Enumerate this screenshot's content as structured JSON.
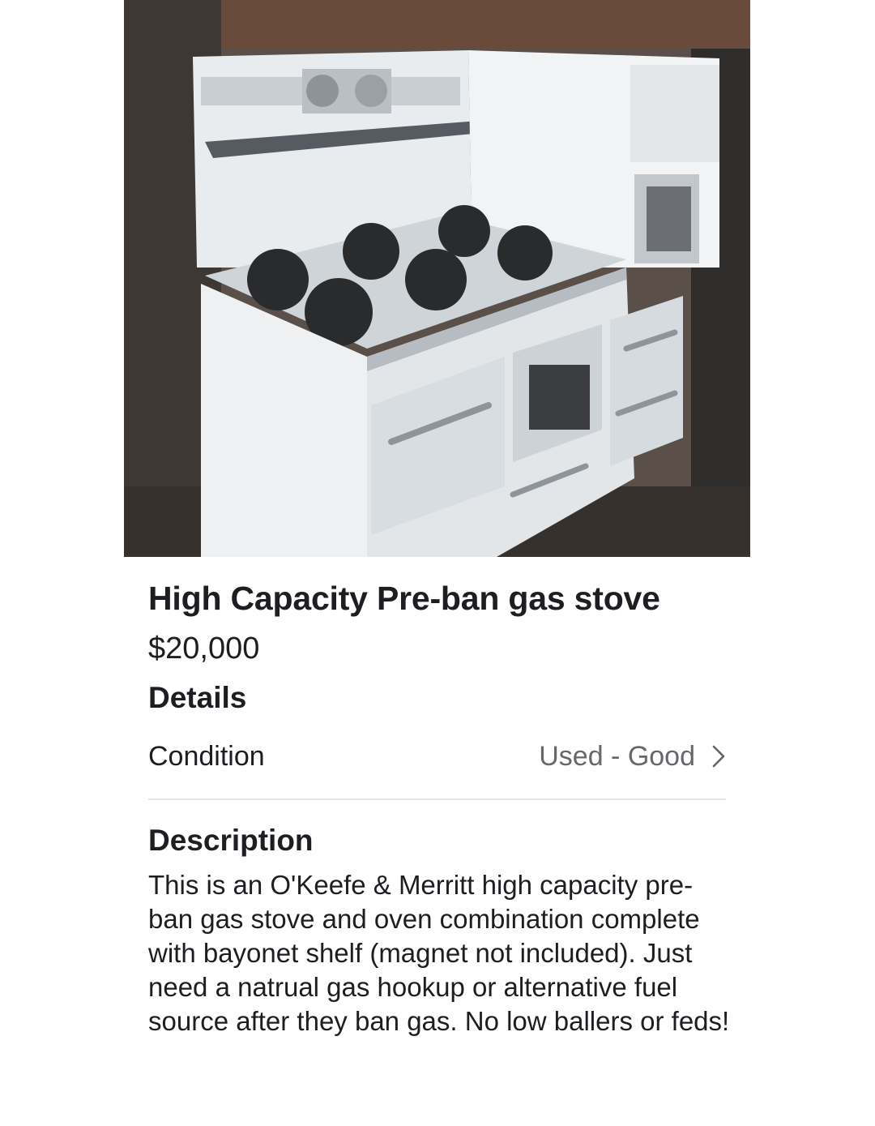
{
  "listing": {
    "title": "High Capacity Pre-ban gas stove",
    "price": "$20,000"
  },
  "details": {
    "heading": "Details",
    "condition_label": "Condition",
    "condition_value": "Used - Good",
    "chevron_icon": "chevron-right-icon"
  },
  "description": {
    "heading": "Description",
    "text": "This is an O'Keefe & Merritt high capacity pre-ban gas stove and oven combination complete with bayonet shelf (magnet not included). Just need a natrual gas hookup or alternative fuel source after they ban gas. No low ballers or feds!"
  },
  "colors": {
    "text_primary": "#1c1e21",
    "text_secondary": "#65676b",
    "divider": "#e4e6eb"
  }
}
